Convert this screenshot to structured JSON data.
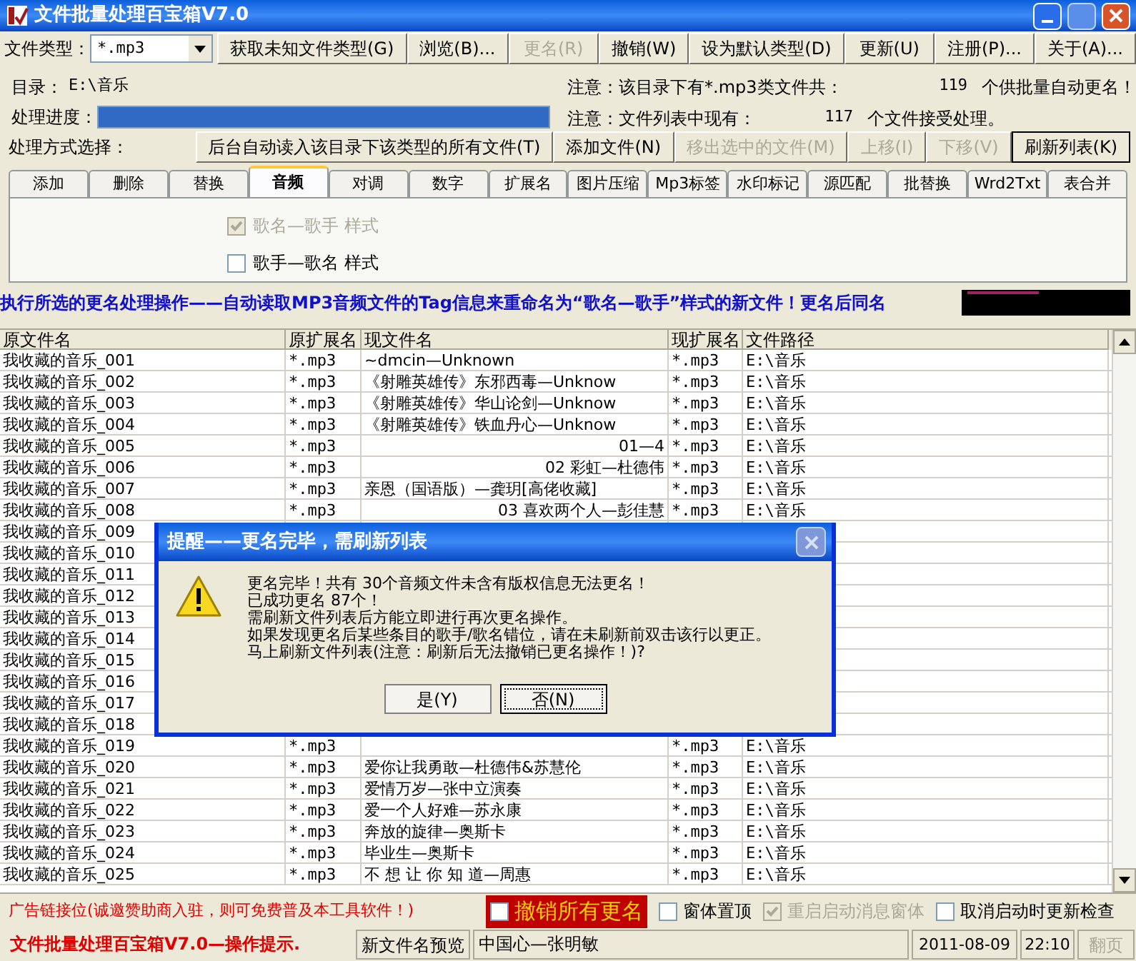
{
  "window": {
    "title": "文件批量处理百宝箱V7.0"
  },
  "toolbar": {
    "file_type_label": "文件类型：",
    "file_type_value": "*.mp3",
    "buttons": [
      {
        "label": "获取未知文件类型(G)",
        "disabled": false
      },
      {
        "label": "浏览(B)...",
        "disabled": false
      },
      {
        "label": "更名(R)",
        "disabled": true
      },
      {
        "label": "撤销(W)",
        "disabled": false
      },
      {
        "label": "设为默认类型(D)",
        "disabled": false
      },
      {
        "label": "更新(U)",
        "disabled": false
      },
      {
        "label": "注册(P)...",
        "disabled": false
      },
      {
        "label": "关于(A)...",
        "disabled": false
      }
    ]
  },
  "directory": {
    "label": "目录：",
    "value": "E:\\音乐"
  },
  "progress": {
    "label": "处理进度：",
    "level": 1.0
  },
  "notes": [
    {
      "prefix": "注意：该目录下有*.mp3类文件共：",
      "count": "119",
      "suffix": "个供批量自动更名！"
    },
    {
      "prefix": "注意：文件列表中现有：",
      "count": "117",
      "suffix": "个文件接受处理。"
    }
  ],
  "method_label": "处理方式选择：",
  "action_buttons": [
    {
      "label": "后台自动读入该目录下该类型的所有文件(T)",
      "disabled": false,
      "default": false
    },
    {
      "label": "添加文件(N)",
      "disabled": false,
      "default": false
    },
    {
      "label": "移出选中的文件(M)",
      "disabled": true,
      "default": false
    },
    {
      "label": "上移(I)",
      "disabled": true,
      "default": false
    },
    {
      "label": "下移(V)",
      "disabled": true,
      "default": false
    },
    {
      "label": "刷新列表(K)",
      "disabled": false,
      "default": true
    }
  ],
  "tabs": [
    {
      "label": "添加",
      "selected": false
    },
    {
      "label": "删除",
      "selected": false
    },
    {
      "label": "替换",
      "selected": false
    },
    {
      "label": "音频",
      "selected": true
    },
    {
      "label": "对调",
      "selected": false
    },
    {
      "label": "数字",
      "selected": false
    },
    {
      "label": "扩展名",
      "selected": false
    },
    {
      "label": "图片压缩",
      "selected": false
    },
    {
      "label": "Mp3标签",
      "selected": false
    },
    {
      "label": "水印标记",
      "selected": false
    },
    {
      "label": "源匹配",
      "selected": false
    },
    {
      "label": "批替换",
      "selected": false
    },
    {
      "label": "Wrd2Txt",
      "selected": false
    },
    {
      "label": "表合并",
      "selected": false
    }
  ],
  "options": [
    {
      "label": "歌名—歌手 样式",
      "checked": true,
      "disabled": true
    },
    {
      "label": "歌手—歌名 样式",
      "checked": false,
      "disabled": false
    }
  ],
  "banner": "执行所选的更名处理操作——自动读取MP3音频文件的Tag信息来重命名为“歌名—歌手”样式的新文件！更名后同名",
  "table": {
    "columns": [
      "原文件名",
      "原扩展名",
      "现文件名",
      "现扩展名",
      "文件路径"
    ],
    "rows": [
      {
        "original_name": "我收藏的音乐_001",
        "original_ext": "*.mp3",
        "current_name": "~dmcin—Unknown",
        "right_aligned": false,
        "current_ext": "*.mp3",
        "path": "E:\\音乐"
      },
      {
        "original_name": "我收藏的音乐_002",
        "original_ext": "*.mp3",
        "current_name": "《射雕英雄传》东邪西毒—Unknow",
        "right_aligned": false,
        "current_ext": "*.mp3",
        "path": "E:\\音乐"
      },
      {
        "original_name": "我收藏的音乐_003",
        "original_ext": "*.mp3",
        "current_name": "《射雕英雄传》华山论剑—Unknow",
        "right_aligned": false,
        "current_ext": "*.mp3",
        "path": "E:\\音乐"
      },
      {
        "original_name": "我收藏的音乐_004",
        "original_ext": "*.mp3",
        "current_name": "《射雕英雄传》铁血丹心—Unknow",
        "right_aligned": false,
        "current_ext": "*.mp3",
        "path": "E:\\音乐"
      },
      {
        "original_name": "我收藏的音乐_005",
        "original_ext": "*.mp3",
        "current_name": "01—4",
        "right_aligned": true,
        "current_ext": "*.mp3",
        "path": "E:\\音乐"
      },
      {
        "original_name": "我收藏的音乐_006",
        "original_ext": "*.mp3",
        "current_name": "02 彩虹—杜德伟",
        "right_aligned": true,
        "current_ext": "*.mp3",
        "path": "E:\\音乐"
      },
      {
        "original_name": "我收藏的音乐_007",
        "original_ext": "*.mp3",
        "current_name": "亲恩（国语版）—龚玥[高佬收藏]",
        "right_aligned": false,
        "current_ext": "*.mp3",
        "path": "E:\\音乐"
      },
      {
        "original_name": "我收藏的音乐_008",
        "original_ext": "*.mp3",
        "current_name": "03 喜欢两个人—彭佳慧",
        "right_aligned": true,
        "current_ext": "*.mp3",
        "path": "E:\\音乐"
      },
      {
        "original_name": "我收藏的音乐_009"
      },
      {
        "original_name": "我收藏的音乐_010"
      },
      {
        "original_name": "我收藏的音乐_011"
      },
      {
        "original_name": "我收藏的音乐_012"
      },
      {
        "original_name": "我收藏的音乐_013"
      },
      {
        "original_name": "我收藏的音乐_014"
      },
      {
        "original_name": "我收藏的音乐_015"
      },
      {
        "original_name": "我收藏的音乐_016"
      },
      {
        "original_name": "我收藏的音乐_017"
      },
      {
        "original_name": "我收藏的音乐_018"
      },
      {
        "original_name": "我收藏的音乐_019",
        "original_ext": "*.mp3",
        "current_ext": "*.mp3",
        "path": "E:\\音乐"
      },
      {
        "original_name": "我收藏的音乐_020",
        "original_ext": "*.mp3",
        "current_name": "爱你让我勇敢—杜德伟&苏慧伦",
        "right_aligned": false,
        "current_ext": "*.mp3",
        "path": "E:\\音乐"
      },
      {
        "original_name": "我收藏的音乐_021",
        "original_ext": "*.mp3",
        "current_name": "爱情万岁—张中立演奏",
        "right_aligned": false,
        "current_ext": "*.mp3",
        "path": "E:\\音乐"
      },
      {
        "original_name": "我收藏的音乐_022",
        "original_ext": "*.mp3",
        "current_name": "爱一个人好难—苏永康",
        "right_aligned": false,
        "current_ext": "*.mp3",
        "path": "E:\\音乐"
      },
      {
        "original_name": "我收藏的音乐_023",
        "original_ext": "*.mp3",
        "current_name": "奔放的旋律—奥斯卡",
        "right_aligned": false,
        "current_ext": "*.mp3",
        "path": "E:\\音乐"
      },
      {
        "original_name": "我收藏的音乐_024",
        "original_ext": "*.mp3",
        "current_name": "毕业生—奥斯卡",
        "right_aligned": false,
        "current_ext": "*.mp3",
        "path": "E:\\音乐"
      },
      {
        "original_name": "我收藏的音乐_025",
        "original_ext": "*.mp3",
        "current_name": "不 想 让 你 知 道—周惠",
        "right_aligned": false,
        "current_ext": "*.mp3",
        "path": "E:\\音乐"
      }
    ]
  },
  "dialog": {
    "title": "提醒——更名完毕，需刷新列表",
    "lines": [
      "更名完毕！共有 30个音频文件未含有版权信息无法更名！",
      "已成功更名 87个！",
      "需刷新文件列表后方能立即进行再次更名操作。",
      "如果发现更名后某些条目的歌手/歌名错位，请在未刷新前双击该行以更正。",
      "马上刷新文件列表(注意：刷新后无法撤销已更名操作！)?"
    ],
    "buttons": [
      {
        "label": "是(Y)",
        "default": false
      },
      {
        "label": "否(N)",
        "default": true
      }
    ]
  },
  "bottom_bar": {
    "ad": "广告链接位(诚邀赞助商入驻，则可免费普及本工具软件！)",
    "undo_all": {
      "label": "撤销所有更名",
      "checked": false
    },
    "checkboxes": [
      {
        "label": "窗体置顶",
        "checked": false,
        "disabled": false
      },
      {
        "label": "重启启动消息窗体",
        "checked": true,
        "disabled": true
      },
      {
        "label": "取消启动时更新检查",
        "checked": false,
        "disabled": false
      }
    ]
  },
  "status_bar": {
    "hint": "文件批量处理百宝箱V7.0—操作提示.",
    "preview_button": "新文件名预览",
    "preview": "中国心—张明敏",
    "date": "2011-08-09",
    "time": "22:10",
    "page_button": "翻页"
  }
}
